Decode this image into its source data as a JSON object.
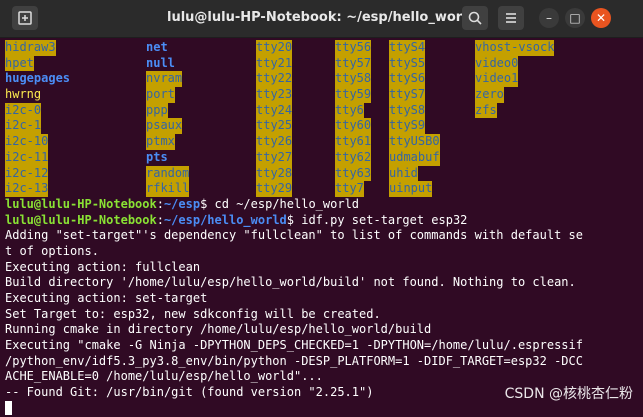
{
  "window": {
    "title": "lulu@lulu-HP-Notebook: ~/esp/hello_world",
    "new_tab_icon": "new-tab-icon",
    "search_icon": "search-icon",
    "menu_icon": "hamburger-menu-icon",
    "minimize": "–",
    "maximize": "□",
    "close": "✕"
  },
  "colors": {
    "bg": "#300a24",
    "dir_bg": "#c4a000",
    "dir_fg": "#3465a4",
    "blue": "#4b8df5",
    "green": "#8ae234",
    "yellow": "#fce94f"
  },
  "listing": [
    [
      "hidraw3",
      "net",
      "tty20",
      "tty56",
      "ttyS4",
      "vhost-vsock"
    ],
    [
      "hpet",
      "null",
      "tty21",
      "tty57",
      "ttyS5",
      "video0"
    ],
    [
      "hugepages",
      "nvram",
      "tty22",
      "tty58",
      "ttyS6",
      "video1"
    ],
    [
      "hwrng",
      "port",
      "tty23",
      "tty59",
      "ttyS7",
      "zero"
    ],
    [
      "i2c-0",
      "ppp",
      "tty24",
      "tty6",
      "ttyS8",
      "zfs"
    ],
    [
      "i2c-1",
      "psaux",
      "tty25",
      "tty60",
      "ttyS9",
      ""
    ],
    [
      "i2c-10",
      "ptmx",
      "tty26",
      "tty61",
      "ttyUSB0",
      ""
    ],
    [
      "i2c-11",
      "pts",
      "tty27",
      "tty62",
      "udmabuf",
      ""
    ],
    [
      "i2c-12",
      "random",
      "tty28",
      "tty63",
      "uhid",
      ""
    ],
    [
      "i2c-13",
      "rfkill",
      "tty29",
      "tty7",
      "uinput",
      ""
    ]
  ],
  "prompt1": {
    "user": "lulu@lulu-HP-Notebook",
    "sep": ":",
    "path": "~/esp",
    "cmd": "$ cd ~/esp/hello_world"
  },
  "prompt2": {
    "user": "lulu@lulu-HP-Notebook",
    "sep": ":",
    "path": "~/esp/hello_world",
    "cmd": "$ idf.py set-target esp32"
  },
  "output": [
    "Adding \"set-target\"'s dependency \"fullclean\" to list of commands with default se",
    "t of options.",
    "Executing action: fullclean",
    "Build directory '/home/lulu/esp/hello_world/build' not found. Nothing to clean.",
    "Executing action: set-target",
    "Set Target to: esp32, new sdkconfig will be created.",
    "Running cmake in directory /home/lulu/esp/hello_world/build",
    "Executing \"cmake -G Ninja -DPYTHON_DEPS_CHECKED=1 -DPYTHON=/home/lulu/.espressif",
    "/python_env/idf5.3_py3.8_env/bin/python -DESP_PLATFORM=1 -DIDF_TARGET=esp32 -DCC",
    "ACHE_ENABLE=0 /home/lulu/esp/hello_world\"...",
    "-- Found Git: /usr/bin/git (found version \"2.25.1\")"
  ],
  "watermark": "CSDN @核桃杏仁粉"
}
